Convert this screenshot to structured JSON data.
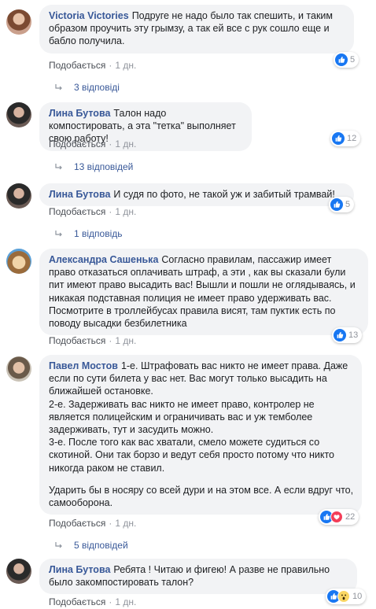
{
  "meta_like": "Подобається",
  "meta_sep": "·",
  "comments": [
    {
      "author": "Victoria Victories",
      "text": "Подруге не надо было так спешить, и таким образом проучить эту грымзу, а так ей все с рук сошло еще и бабло получила.",
      "time": "1 дн.",
      "reaction_count": "5",
      "replies": "3 відповіді"
    },
    {
      "author": "Лина Бутова",
      "text": "Талон надо компостировать, а эта \"тетка\" выполняет свою работу!",
      "time": "1 дн.",
      "reaction_count": "12",
      "replies": "13 відповідей"
    },
    {
      "author": "Лина Бутова",
      "text": "И судя по фото, не такой уж и забитый трамвай!",
      "time": "1 дн.",
      "reaction_count": "5",
      "replies": "1 відповідь"
    },
    {
      "author": "Александра Сашенька",
      "text": "Согласно правилам, пассажир имеет право отказаться оплачивать штраф, а эти , как вы сказали були пит имеют право высадить вас! Вышли и пошли не оглядываясь, и никакая подставная полиция не имеет право удерживать вас. Посмотрите в троллейбусах правила висят, там пуктик есть по поводу высадки безбилетника",
      "time": "1 дн.",
      "reaction_count": "13"
    },
    {
      "author": "Павел Мостов",
      "text": "1-е. Штрафовать вас никто не имеет права. Даже если по сути билета у вас нет. Вас могут только высадить на ближайшей остановке.\n2-е. Задерживать вас никто не имеет право, контролер не является полицейским и ограничивать вас и уж темболее задерживать, тут и засудить можно.\n3-е. После того как вас хватали, смело можете судиться со скотиной. Они так борзо и ведут себя просто потому что никто никогда раком не ставил.",
      "text2": "Ударить бы в носяру со всей дури и на этом все. А если вдруг что, самооборона.",
      "time": "1 дн.",
      "reaction_count": "22",
      "replies": "5 відповідей"
    },
    {
      "author": "Лина Бутова",
      "text": "Ребята ! Читаю и фигею! А разве не правильно было закомпостировать талон?",
      "time": "1 дн.",
      "reaction_count": "10"
    }
  ],
  "colors": {
    "bubble": "#f2f3f5",
    "author": "#385898",
    "like": "#1877f2",
    "love": "#f33e58",
    "wow": "#fad664"
  }
}
